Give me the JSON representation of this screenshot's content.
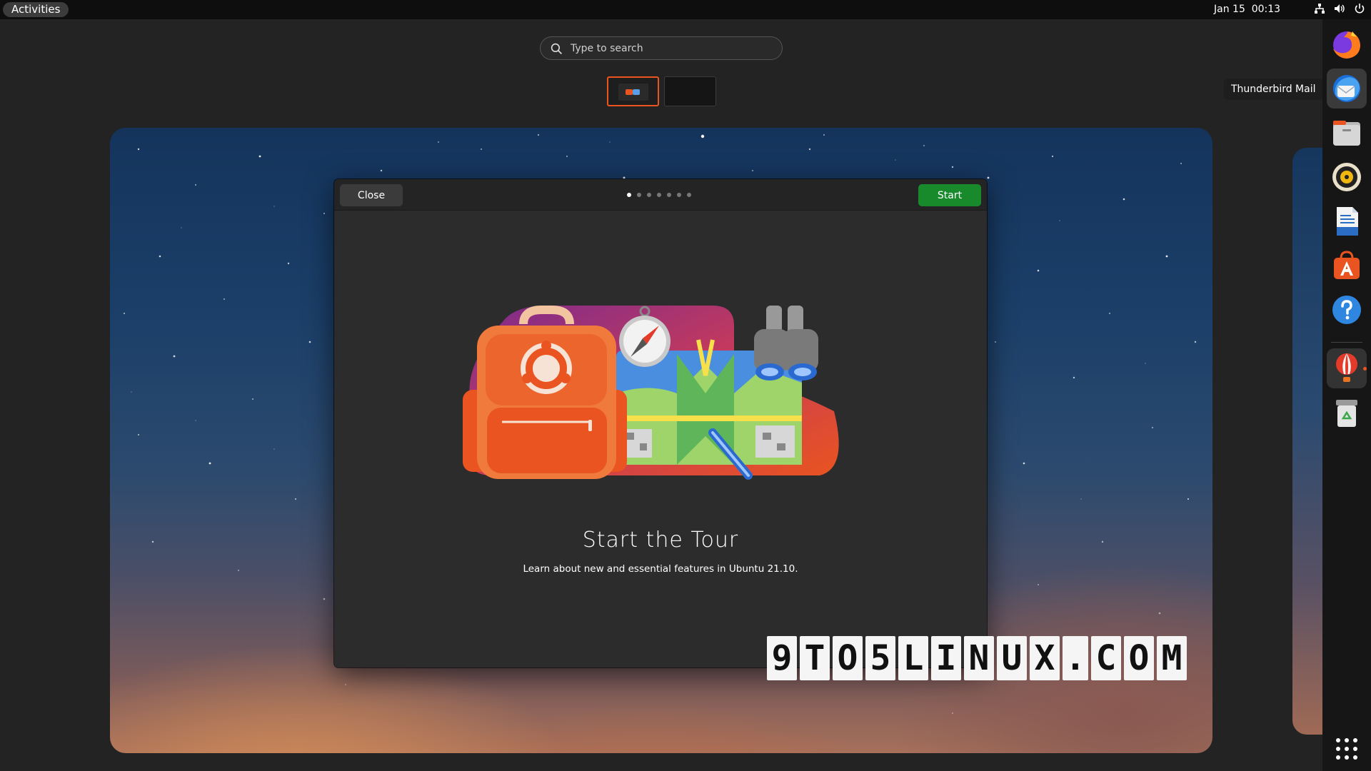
{
  "topbar": {
    "activities_label": "Activities",
    "clock": "Jan 15  00:13",
    "tray_icons": [
      "network-icon",
      "volume-icon",
      "power-icon"
    ]
  },
  "search": {
    "placeholder": "Type to search"
  },
  "workspaces": {
    "count": 2,
    "active_index": 0
  },
  "welcome_window": {
    "close_label": "Close",
    "start_label": "Start",
    "pages_total": 7,
    "current_page": 1,
    "title": "Start the Tour",
    "subtitle": "Learn about new and essential features in Ubuntu 21.10."
  },
  "watermark": {
    "letters": [
      "9",
      "T",
      "O",
      "5",
      "L",
      "I",
      "N",
      "U",
      "X",
      ".",
      "C",
      "O",
      "M"
    ]
  },
  "dock": {
    "tooltip": "Thunderbird Mail",
    "items": [
      {
        "name": "firefox-icon"
      },
      {
        "name": "thunderbird-icon"
      },
      {
        "name": "files-icon"
      },
      {
        "name": "rhythmbox-icon"
      },
      {
        "name": "libreoffice-writer-icon"
      },
      {
        "name": "ubuntu-software-icon"
      },
      {
        "name": "help-icon"
      },
      {
        "name": "welcome-balloon-icon"
      },
      {
        "name": "trash-icon"
      }
    ],
    "show_apps": "show-apps-grid-icon"
  },
  "colors": {
    "accent": "#e95420",
    "start_button": "#188a2c",
    "topbar": "#0e0e0e",
    "dock": "#161616",
    "window": "#2c2c2c"
  }
}
